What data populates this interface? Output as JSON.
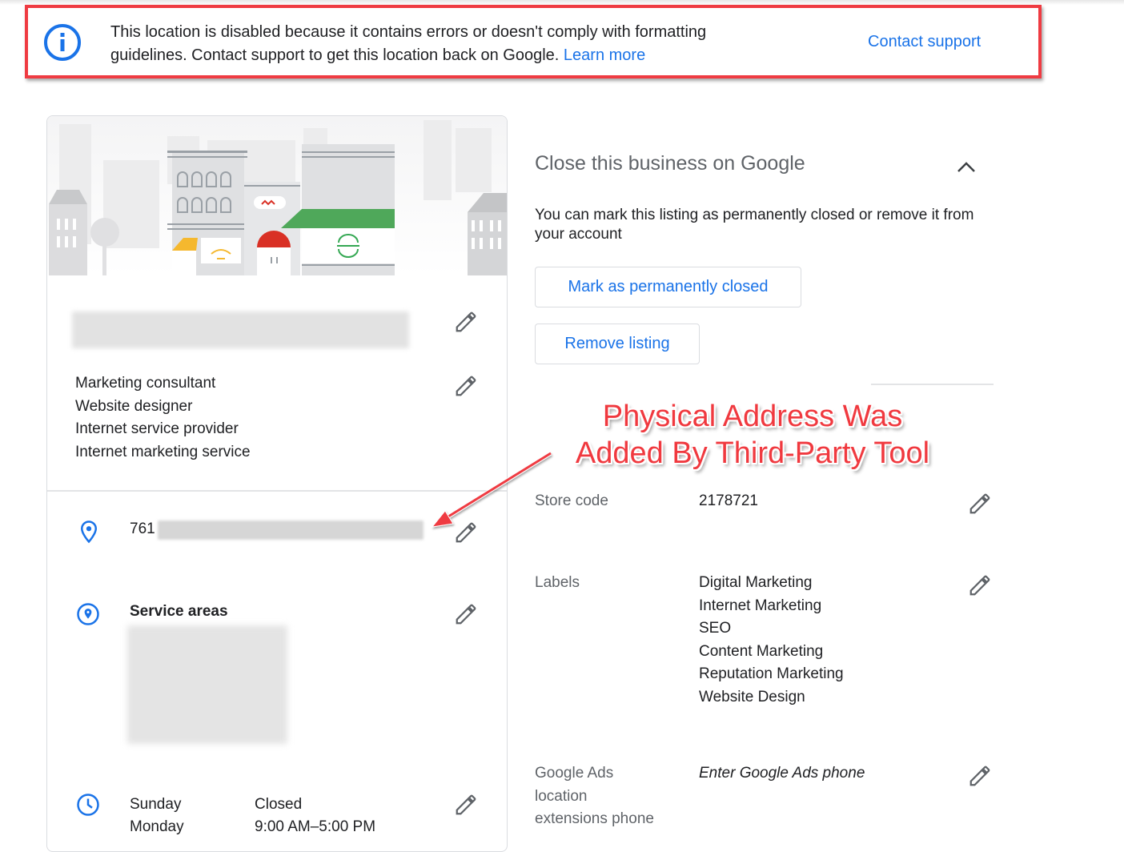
{
  "alert": {
    "icon": "info-icon",
    "message": "This location is disabled because it contains errors or doesn't comply with formatting guidelines. Contact support to get this location back on Google.",
    "learn_more": "Learn more",
    "contact_support": "Contact support",
    "border_color": "#ef3b42"
  },
  "business_card": {
    "name_redacted": true,
    "categories": [
      "Marketing consultant",
      "Website designer",
      "Internet service provider",
      "Internet marketing service"
    ],
    "address_prefix": "761",
    "address_redacted": true,
    "service_areas_title": "Service areas",
    "service_areas_redacted": true,
    "hours": [
      {
        "day": "Sunday",
        "time": "Closed"
      },
      {
        "day": "Monday",
        "time": "9:00 AM–5:00 PM"
      }
    ]
  },
  "close_section": {
    "title": "Close this business on Google",
    "description": "You can mark this listing as permanently closed or remove it from your account",
    "mark_closed_button": "Mark as permanently closed",
    "remove_listing_button": "Remove listing"
  },
  "annotation": {
    "line1": "Physical Address Was",
    "line2": "Added By Third-Party Tool",
    "color": "#f0393f"
  },
  "fields": {
    "store_code": {
      "label": "Store code",
      "value": "2178721"
    },
    "labels": {
      "label": "Labels",
      "values": [
        "Digital Marketing",
        "Internet Marketing",
        "SEO",
        "Content Marketing",
        "Reputation Marketing",
        "Website Design"
      ]
    },
    "ads_phone": {
      "label_lines": [
        "Google Ads",
        "location",
        "extensions phone"
      ],
      "placeholder": "Enter Google Ads phone"
    }
  },
  "colors": {
    "link_blue": "#1a73e8",
    "icon_grey": "#5f6368",
    "text": "#202124"
  }
}
